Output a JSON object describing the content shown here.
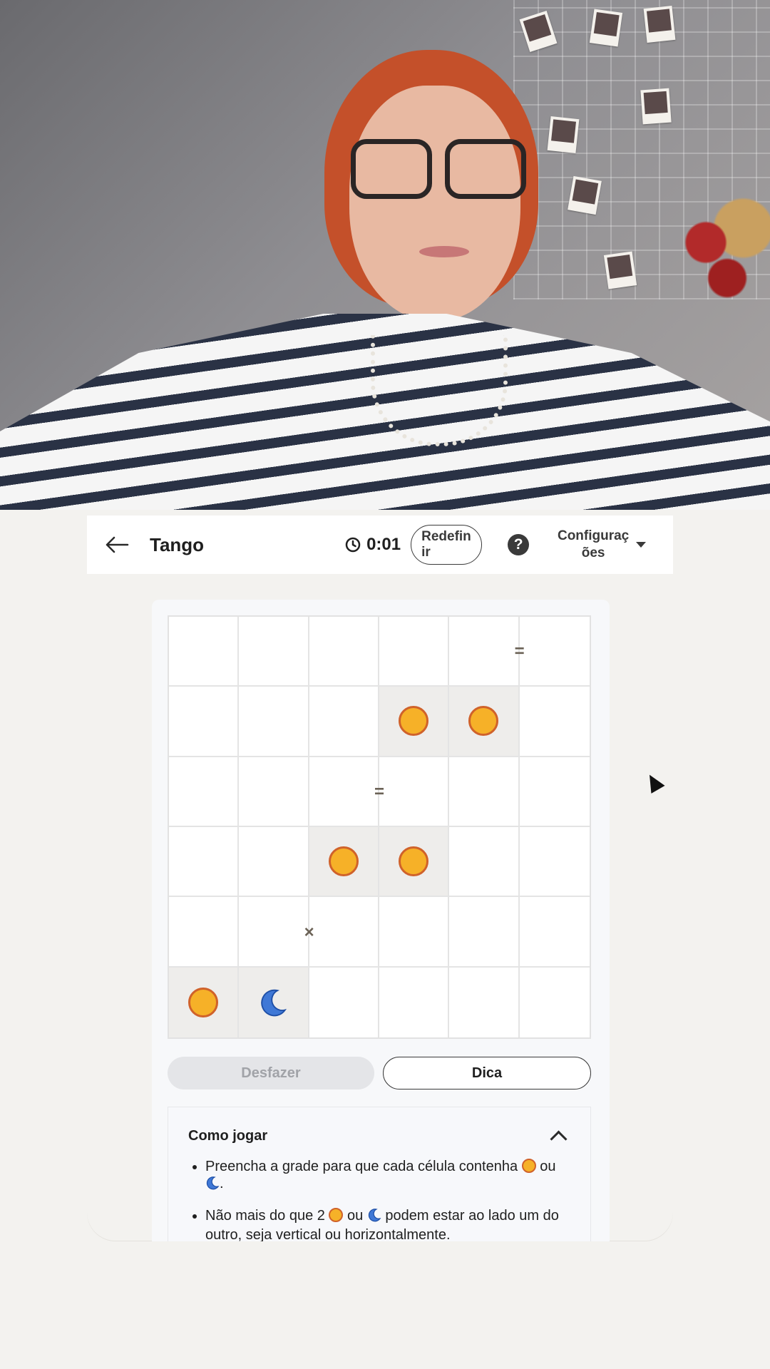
{
  "header": {
    "title": "Tango",
    "timer": "0:01",
    "reset_label": "Redefinir",
    "help_label": "?",
    "settings_label": "Configurações"
  },
  "board": {
    "cells": [
      [
        "",
        "",
        "",
        "",
        "",
        ""
      ],
      [
        "",
        "",
        "",
        "sun",
        "sun",
        ""
      ],
      [
        "",
        "",
        "",
        "",
        "",
        ""
      ],
      [
        "",
        "",
        "sun",
        "sun",
        "",
        ""
      ],
      [
        "",
        "",
        "",
        "",
        "",
        ""
      ],
      [
        "sun",
        "moon",
        "",
        "",
        "",
        ""
      ]
    ],
    "locked": [
      [
        false,
        false,
        false,
        false,
        false,
        false
      ],
      [
        false,
        false,
        false,
        true,
        true,
        false
      ],
      [
        false,
        false,
        false,
        false,
        false,
        false
      ],
      [
        false,
        false,
        true,
        true,
        false,
        false
      ],
      [
        false,
        false,
        false,
        false,
        false,
        false
      ],
      [
        true,
        true,
        false,
        false,
        false,
        false
      ]
    ],
    "constraints": [
      {
        "symbol": "=",
        "between": [
          [
            0,
            4
          ],
          [
            0,
            5
          ]
        ]
      },
      {
        "symbol": "=",
        "between": [
          [
            2,
            2
          ],
          [
            2,
            3
          ]
        ]
      },
      {
        "symbol": "×",
        "between": [
          [
            4,
            1
          ],
          [
            4,
            2
          ]
        ]
      }
    ]
  },
  "actions": {
    "undo_label": "Desfazer",
    "hint_label": "Dica"
  },
  "how_to_play": {
    "title": "Como jogar",
    "rule1_text": "Preencha a grade para que cada célula contenha",
    "rule1_or": "ou",
    "rule1_end": ".",
    "rule2_text_a": "Não mais do que 2",
    "rule2_or": "ou",
    "rule2_text_b": "podem estar ao lado um do outro, seja vertical ou horizontalmente."
  },
  "colors": {
    "sun_fill": "#f6b128",
    "sun_border": "#d0622a",
    "moon_fill": "#3f78d6"
  }
}
